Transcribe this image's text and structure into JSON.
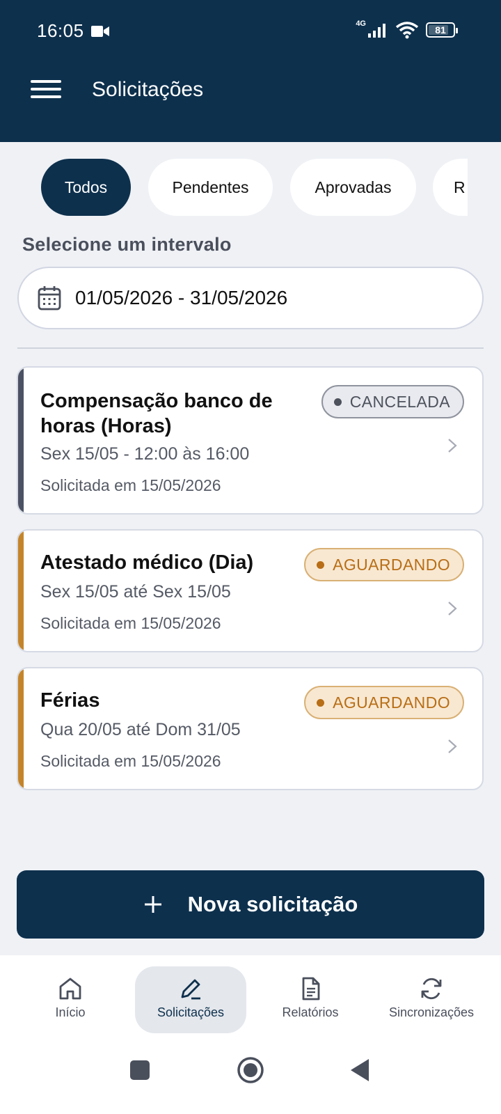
{
  "status_bar": {
    "time": "16:05",
    "network": "4G",
    "battery": "81",
    "battery_level": 0.81
  },
  "app_bar": {
    "title": "Solicitações",
    "menu_icon": "menu-icon"
  },
  "filters": {
    "chips": [
      {
        "label": "Todos",
        "active": true
      },
      {
        "label": "Pendentes",
        "active": false
      },
      {
        "label": "Aprovadas",
        "active": false
      },
      {
        "label": "R",
        "active": false
      }
    ]
  },
  "interval": {
    "label": "Selecione um intervalo",
    "value": "01/05/2026 - 31/05/2026",
    "icon": "calendar-icon"
  },
  "requests": [
    {
      "title_line1": "Compensação banco de",
      "title_line2": "horas (Horas)",
      "period": "Sex 15/05 - 12:00 às 16:00",
      "requested": "Solicitada em 15/05/2026",
      "status": "CANCELADA",
      "accent": "#4b5263"
    },
    {
      "title_line1": "Atestado médico (Dia)",
      "period": "Sex 15/05 até Sex 15/05",
      "requested": "Solicitada em 15/05/2026",
      "status": "AGUARDANDO",
      "accent": "#c4852a"
    },
    {
      "title_line1": "Férias",
      "period": "Qua 20/05 até Dom 31/05",
      "requested": "Solicitada em 15/05/2026",
      "status": "AGUARDANDO",
      "accent": "#c4852a"
    }
  ],
  "new_request": {
    "label": "Nova solicitação",
    "icon": "plus-icon"
  },
  "bottom_nav": [
    {
      "label": "Início",
      "icon": "home-icon",
      "active": false
    },
    {
      "label": "Solicitações",
      "icon": "pencil-icon",
      "active": true
    },
    {
      "label": "Relatórios",
      "icon": "document-icon",
      "active": false
    },
    {
      "label": "Sincronizações",
      "icon": "sync-icon",
      "active": false
    }
  ],
  "colors": {
    "primary": "#0d304d",
    "background": "#eff1f5",
    "pending": "#b86e16",
    "cancelled": "#4d525c"
  }
}
